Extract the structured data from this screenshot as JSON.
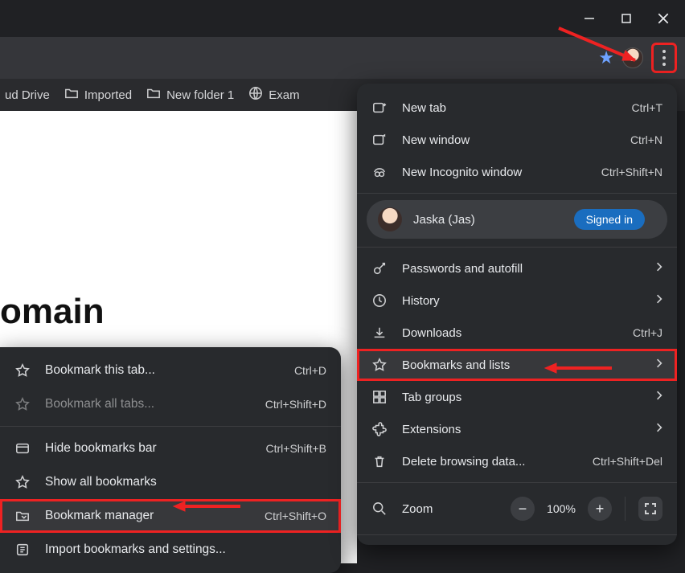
{
  "window_controls": {
    "minimize": "minimize",
    "maximize": "maximize",
    "close": "close"
  },
  "toolbar": {
    "bookmark_star": "bookmark-star",
    "profile_avatar": "avatar",
    "menu_button": "menu"
  },
  "bookmark_bar": [
    {
      "label": "ud Drive",
      "type": "folder-fragment"
    },
    {
      "label": "Imported",
      "type": "folder"
    },
    {
      "label": "New folder 1",
      "type": "folder"
    },
    {
      "label": "Exam",
      "type": "globe-fragment"
    }
  ],
  "page": {
    "heading_fragment": "omain"
  },
  "main_menu": {
    "group1": [
      {
        "icon": "new-tab",
        "label": "New tab",
        "shortcut": "Ctrl+T"
      },
      {
        "icon": "new-window",
        "label": "New window",
        "shortcut": "Ctrl+N"
      },
      {
        "icon": "incognito",
        "label": "New Incognito window",
        "shortcut": "Ctrl+Shift+N"
      }
    ],
    "profile": {
      "name": "Jaska (Jas)",
      "status_chip": "Signed in"
    },
    "group2": [
      {
        "icon": "key",
        "label": "Passwords and autofill",
        "chevron": true
      },
      {
        "icon": "history",
        "label": "History",
        "chevron": true
      },
      {
        "icon": "download",
        "label": "Downloads",
        "shortcut": "Ctrl+J"
      },
      {
        "icon": "star",
        "label": "Bookmarks and lists",
        "chevron": true,
        "highlight": true
      },
      {
        "icon": "tab-groups",
        "label": "Tab groups",
        "chevron": true
      },
      {
        "icon": "extensions",
        "label": "Extensions",
        "chevron": true
      },
      {
        "icon": "trash",
        "label": "Delete browsing data...",
        "shortcut": "Ctrl+Shift+Del"
      }
    ],
    "zoom": {
      "icon": "zoom",
      "label": "Zoom",
      "value": "100%",
      "minus": "−",
      "plus": "+",
      "fullscreen": "fullscreen"
    }
  },
  "submenu": {
    "group1": [
      {
        "icon": "star-outline",
        "label": "Bookmark this tab...",
        "shortcut": "Ctrl+D"
      },
      {
        "icon": "star-outline",
        "label": "Bookmark all tabs...",
        "shortcut": "Ctrl+Shift+D",
        "dim": true
      }
    ],
    "group2": [
      {
        "icon": "hide",
        "label": "Hide bookmarks bar",
        "shortcut": "Ctrl+Shift+B"
      },
      {
        "icon": "star-outline",
        "label": "Show all bookmarks"
      },
      {
        "icon": "bookmark-manager",
        "label": "Bookmark manager",
        "shortcut": "Ctrl+Shift+O",
        "highlight": true
      },
      {
        "icon": "import",
        "label": "Import bookmarks and settings..."
      }
    ]
  }
}
